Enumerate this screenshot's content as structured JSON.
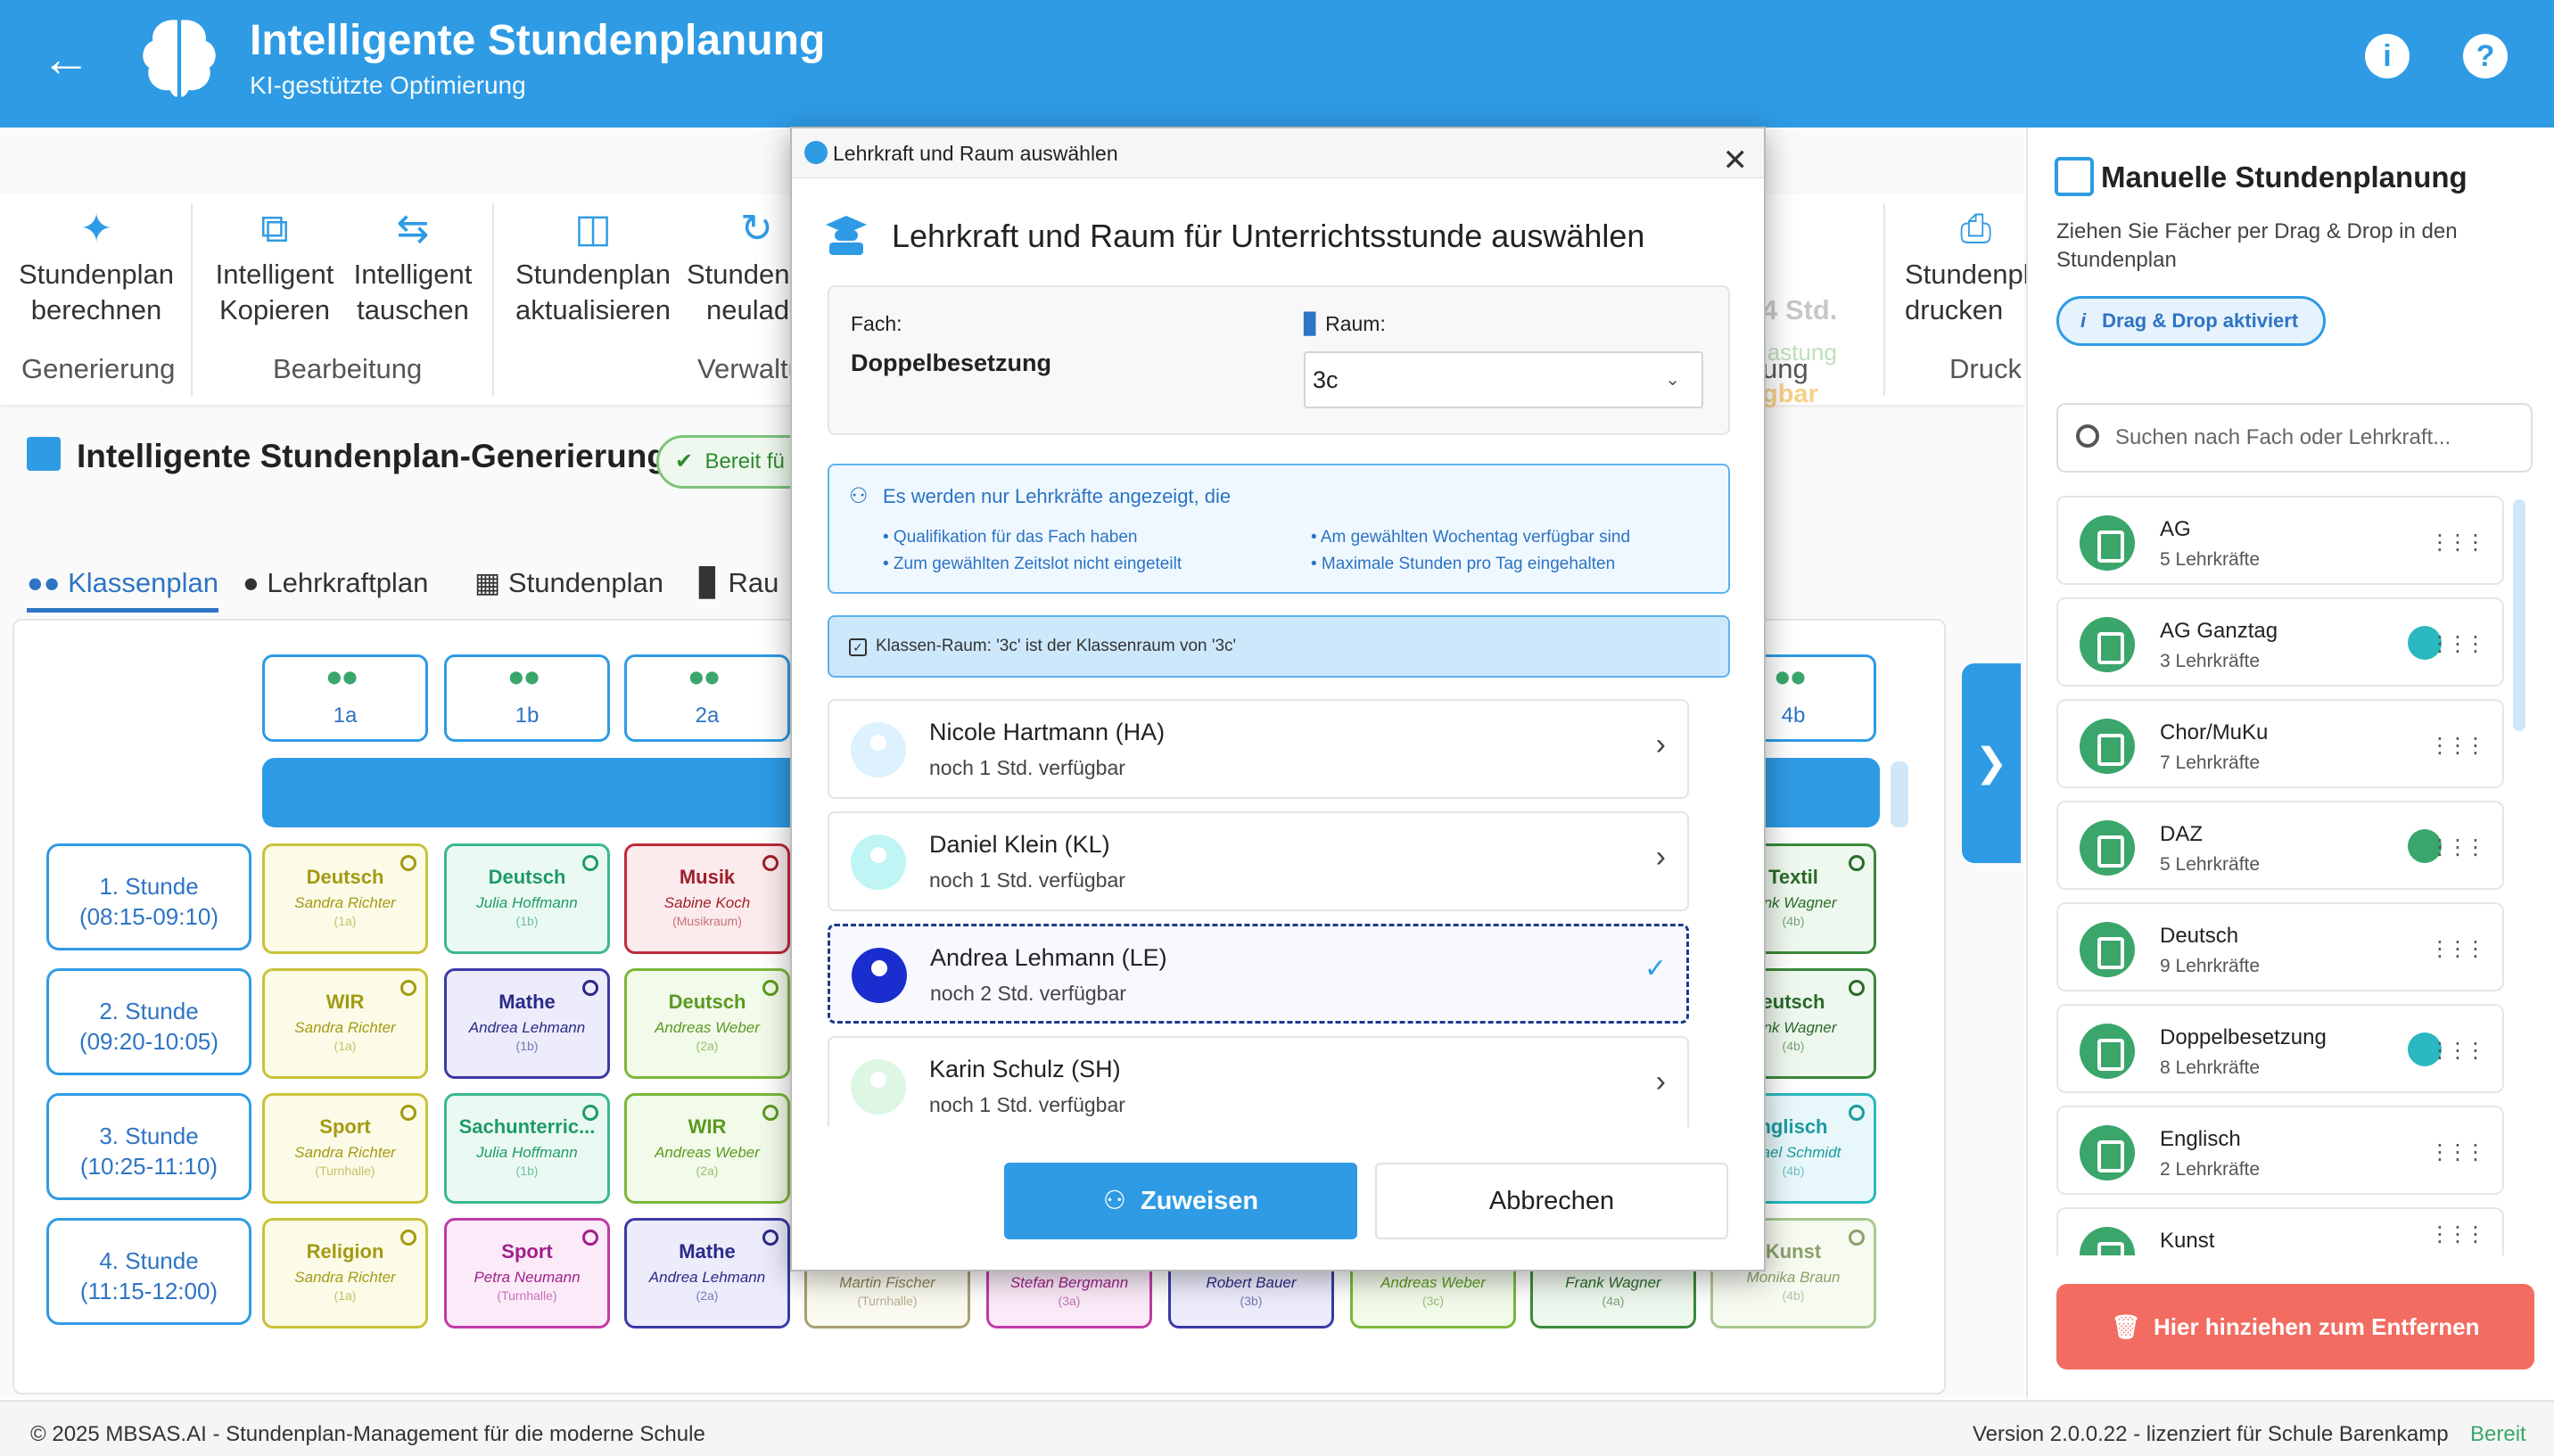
{
  "header": {
    "title": "Intelligente Stundenplanung",
    "subtitle": "KI-gestützte Optimierung"
  },
  "ribbon": {
    "buttons": [
      {
        "line1": "Stundenplan",
        "line2": "berechnen"
      },
      {
        "line1": "Intelligent",
        "line2": "Kopieren"
      },
      {
        "line1": "Intelligent",
        "line2": "tauschen"
      },
      {
        "line1": "Stundenplan",
        "line2": "aktualisieren"
      },
      {
        "line1": "Stundenp",
        "line2": "neulad"
      },
      {
        "line1": "Stundenpl",
        "line2": "drucken"
      }
    ],
    "groups": [
      "Generierung",
      "Bearbeitung",
      "Verwaltu",
      "ung",
      "Druck"
    ],
    "partial": {
      "hours": "4 Std.",
      "load": "lastung",
      "available": "gbar"
    }
  },
  "section": {
    "title": "Intelligente Stundenplan-Generierung",
    "status": "Bereit fü"
  },
  "tabs": [
    "Klassenplan",
    "Lehrkraftplan",
    "Stundenplan",
    "Rau"
  ],
  "classes": [
    "1a",
    "1b",
    "2a",
    "4b"
  ],
  "periods": [
    {
      "name": "1. Stunde",
      "time": "(08:15-09:10)"
    },
    {
      "name": "2. Stunde",
      "time": "(09:20-10:05)"
    },
    {
      "name": "3. Stunde",
      "time": "(10:25-11:10)"
    },
    {
      "name": "4. Stunde",
      "time": "(11:15-12:00)"
    }
  ],
  "lessons": {
    "c1a": [
      {
        "subject": "Deutsch",
        "teacher": "Sandra Richter",
        "room": "(1a)"
      },
      {
        "subject": "WIR",
        "teacher": "Sandra Richter",
        "room": "(1a)"
      },
      {
        "subject": "Sport",
        "teacher": "Sandra Richter",
        "room": "(Turnhalle)"
      },
      {
        "subject": "Religion",
        "teacher": "Sandra Richter",
        "room": "(1a)"
      }
    ],
    "c1b": [
      {
        "subject": "Deutsch",
        "teacher": "Julia Hoffmann",
        "room": "(1b)"
      },
      {
        "subject": "Mathe",
        "teacher": "Andrea Lehmann",
        "room": "(1b)"
      },
      {
        "subject": "Sachunterric...",
        "teacher": "Julia Hoffmann",
        "room": "(1b)"
      },
      {
        "subject": "Sport",
        "teacher": "Petra Neumann",
        "room": "(Turnhalle)"
      }
    ],
    "c2a": [
      {
        "subject": "Musik",
        "teacher": "Sabine Koch",
        "room": "(Musikraum)"
      },
      {
        "subject": "Deutsch",
        "teacher": "Andreas Weber",
        "room": "(2a)"
      },
      {
        "subject": "WIR",
        "teacher": "Andreas Weber",
        "room": "(2a)"
      },
      {
        "subject": "Mathe",
        "teacher": "Andrea Lehmann",
        "room": "(2a)"
      }
    ],
    "c4b": [
      {
        "subject": "Textil",
        "teacher": "rank Wagner",
        "room": "(4b)"
      },
      {
        "subject": "eutsch",
        "teacher": "rank Wagner",
        "room": "(4b)"
      },
      {
        "subject": "nglisch",
        "teacher": "chael Schmidt",
        "room": "(4b)"
      },
      {
        "subject": "Kunst",
        "teacher": "Monika Braun",
        "room": "(4b)"
      }
    ],
    "bottom_row": [
      {
        "teacher": "Martin Fischer",
        "room": "(Turnhalle)"
      },
      {
        "teacher": "Stefan Bergmann",
        "room": "(3a)"
      },
      {
        "teacher": "Robert Bauer",
        "room": "(3b)"
      },
      {
        "teacher": "Andreas Weber",
        "room": "(3c)"
      },
      {
        "teacher": "Frank Wagner",
        "room": "(4a)"
      }
    ]
  },
  "dialog": {
    "window_title": "Lehrkraft und Raum auswählen",
    "heading": "Lehrkraft und Raum für Unterrichtsstunde auswählen",
    "subject_label": "Fach:",
    "subject_value": "Doppelbesetzung",
    "room_label": "Raum:",
    "room_value": "3c",
    "info_title": "Es werden nur Lehrkräfte angezeigt, die",
    "info_bullets": [
      "• Qualifikation für das Fach haben",
      "• Zum gewählten Zeitslot nicht eingeteilt",
      "• Am gewählten Wochentag verfügbar sind",
      "• Maximale Stunden pro Tag eingehalten"
    ],
    "checkbox_text": "Klassen-Raum: '3c' ist der Klassenraum von '3c'",
    "teachers": [
      {
        "name": "Nicole Hartmann  (HA)",
        "status": "noch 1 Std. verfügbar"
      },
      {
        "name": "Daniel Klein  (KL)",
        "status": "noch 1 Std. verfügbar"
      },
      {
        "name": "Andrea Lehmann  (LE)",
        "status": "noch 2 Std. verfügbar"
      },
      {
        "name": "Karin Schulz  (SH)",
        "status": "noch 1 Std. verfügbar"
      }
    ],
    "assign_label": "Zuweisen",
    "cancel_label": "Abbrechen"
  },
  "sidebar": {
    "title": "Manuelle Stundenplanung",
    "description": "Ziehen Sie Fächer per Drag & Drop in den Stundenplan",
    "dragdrop_label": "Drag & Drop aktiviert",
    "search_placeholder": "Suchen nach Fach oder Lehrkraft...",
    "subjects": [
      {
        "name": "AG",
        "count": "5 Lehrkräfte"
      },
      {
        "name": "AG Ganztag",
        "count": "3 Lehrkräfte"
      },
      {
        "name": "Chor/MuKu",
        "count": "7 Lehrkräfte"
      },
      {
        "name": "DAZ",
        "count": "5 Lehrkräfte"
      },
      {
        "name": "Deutsch",
        "count": "9 Lehrkräfte"
      },
      {
        "name": "Doppelbesetzung",
        "count": "8 Lehrkräfte"
      },
      {
        "name": "Englisch",
        "count": "2 Lehrkräfte"
      },
      {
        "name": "Kunst",
        "count": ""
      }
    ],
    "remove_label": "Hier hinziehen zum Entfernen"
  },
  "footer": {
    "copyright": "© 2025 MBSAS.AI - Stundenplan-Management für die moderne Schule",
    "version": "Version 2.0.0.22 - lizenziert für Schule Barenkamp",
    "status": "Bereit"
  },
  "colors": {
    "primary": "#2e9be4",
    "success": "#3aa66b",
    "danger": "#f36c61",
    "selected_avatar": "#1a2ecf"
  }
}
